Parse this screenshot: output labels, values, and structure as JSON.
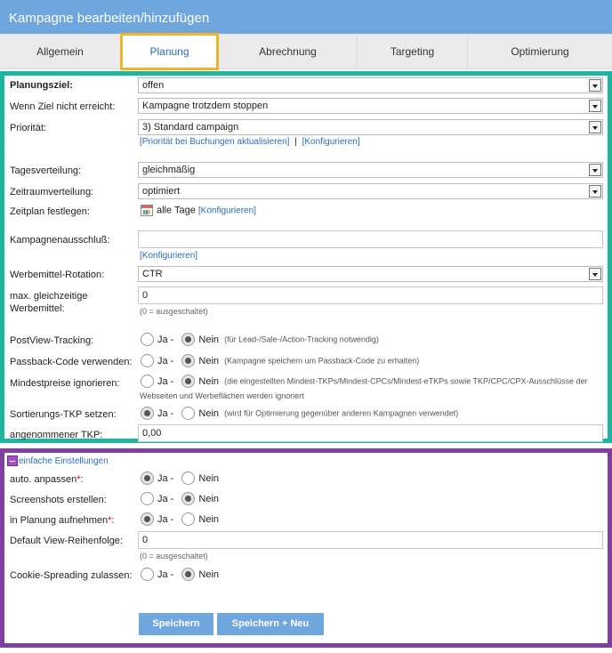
{
  "window": {
    "title": "Kampagne bearbeiten/hinzufügen"
  },
  "tabs": [
    "Allgemein",
    "Planung",
    "Abrechnung",
    "Targeting",
    "Optimierung"
  ],
  "fields": {
    "planungsziel": {
      "label": "Planungsziel:",
      "value": "offen"
    },
    "ziel_nicht_erreicht": {
      "label": "Wenn Ziel nicht erreicht:",
      "value": "Kampagne trotzdem stoppen"
    },
    "prioritaet": {
      "label": "Priorität:",
      "value": "3) Standard campaign",
      "link1": "[Priorität bei Buchungen aktualisieren]",
      "sep": "|",
      "link2": "[Konfigurieren]"
    },
    "tagesverteilung": {
      "label": "Tagesverteilung:",
      "value": "gleichmäßig"
    },
    "zeitraumverteilung": {
      "label": "Zeitraumverteilung:",
      "value": "optimiert"
    },
    "zeitplan": {
      "label": "Zeitplan festlegen:",
      "value": "alle Tage",
      "link": "[Konfigurieren]"
    },
    "kampagnenausschluss": {
      "label": "Kampagnenausschluß:",
      "value": "",
      "link": "[Konfigurieren]"
    },
    "rotation": {
      "label": "Werbemittel-Rotation:",
      "value": "CTR"
    },
    "max_werbemittel": {
      "label1": "max. gleichzeitige",
      "label2": "Werbemittel:",
      "value": "0",
      "hint": "(0 = ausgeschaltet)"
    },
    "postview": {
      "label": "PostView-Tracking:",
      "ja": "Ja -",
      "nein": "Nein",
      "note": "(für Lead-/Sale-/Action-Tracking notwendig)"
    },
    "passback": {
      "label": "Passback-Code verwenden:",
      "ja": "Ja -",
      "nein": "Nein",
      "note": "(Kampagne speichern um Passback-Code zu erhalten)"
    },
    "mindestpreise": {
      "label": "Mindestpreise ignorieren:",
      "ja": "Ja -",
      "nein": "Nein",
      "note1": "(die eingestellten Mindest-TKPs/Mindest-CPCs/Mindest-eTKPs sowie TKP/CPC/CPX-Ausschlüsse der",
      "note2": "Webseiten und Werbeflächen werden ignoriert"
    },
    "sortierung": {
      "label": "Sortierungs-TKP setzen:",
      "ja": "Ja -",
      "nein": "Nein",
      "note": "(wird für Optimierung gegenüber anderen Kampagnen verwendet)"
    },
    "tkp": {
      "label": "angenommener TKP:",
      "value": "0,00"
    }
  },
  "simple": {
    "toggle_label": "einfache Einstellungen",
    "auto": {
      "label": "auto. anpassen",
      "star": "*",
      "colon": ":",
      "ja": "Ja -",
      "nein": "Nein"
    },
    "screenshots": {
      "label": "Screenshots erstellen:",
      "ja": "Ja -",
      "nein": "Nein"
    },
    "planung": {
      "label": "in Planung aufnehmen",
      "star": "*",
      "colon": ":",
      "ja": "Ja -",
      "nein": "Nein"
    },
    "default_view": {
      "label": "Default View-Reihenfolge:",
      "value": "0",
      "hint": "(0 = ausgeschaltet)"
    },
    "cookie": {
      "label": "Cookie-Spreading zulassen:",
      "ja": "Ja -",
      "nein": "Nein"
    }
  },
  "buttons": {
    "save": "Speichern",
    "save_new": "Speichern + Neu"
  }
}
